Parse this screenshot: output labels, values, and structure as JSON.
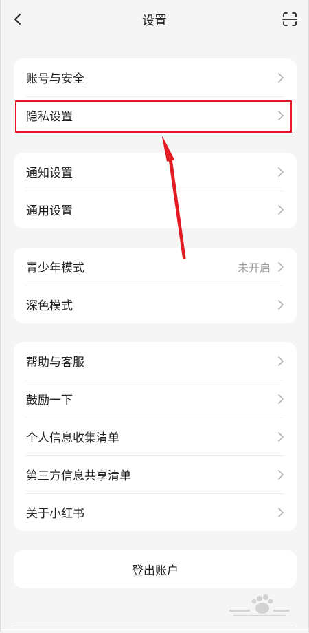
{
  "header": {
    "title": "设置",
    "back_icon": "chevron-left-icon",
    "scan_icon": "scan-icon"
  },
  "groups": [
    {
      "items": [
        {
          "label": "账号与安全",
          "value": ""
        },
        {
          "label": "隐私设置",
          "value": ""
        }
      ]
    },
    {
      "items": [
        {
          "label": "通知设置",
          "value": ""
        },
        {
          "label": "通用设置",
          "value": ""
        }
      ]
    },
    {
      "items": [
        {
          "label": "青少年模式",
          "value": "未开启"
        },
        {
          "label": "深色模式",
          "value": ""
        }
      ]
    },
    {
      "items": [
        {
          "label": "帮助与客服",
          "value": ""
        },
        {
          "label": "鼓励一下",
          "value": ""
        },
        {
          "label": "个人信息收集清单",
          "value": ""
        },
        {
          "label": "第三方信息共享清单",
          "value": ""
        },
        {
          "label": "关于小红书",
          "value": ""
        }
      ]
    }
  ],
  "logout": {
    "label": "登出账户"
  },
  "annotation": {
    "color": "#e31b23",
    "highlighted_item": "隐私设置"
  },
  "colors": {
    "background": "#f5f5f5",
    "card": "#ffffff",
    "accent": "#e31b23"
  }
}
